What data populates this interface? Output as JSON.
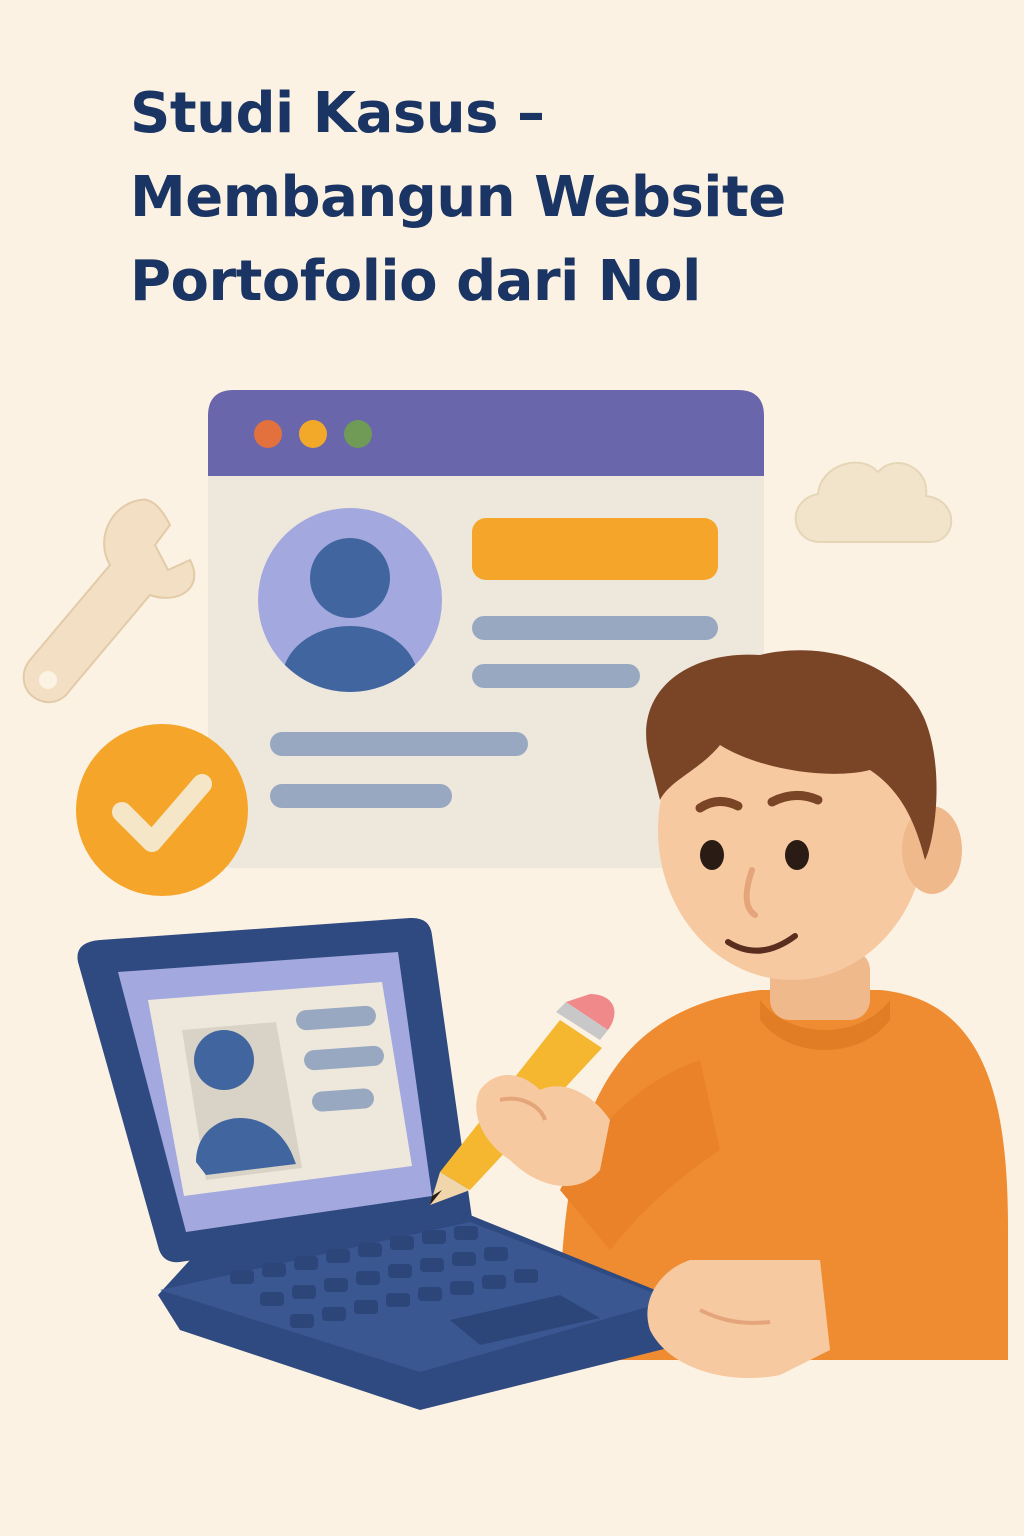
{
  "title": {
    "lines": [
      "Studi Kasus –",
      "Membangun Website",
      "Portofolio dari Nol"
    ]
  },
  "colors": {
    "background": "#fcf2e3",
    "title": "#1a3563",
    "browser_header": "#6a66ac",
    "browser_body": "#eee8dc",
    "accent_orange": "#f4a52a",
    "avatar_blue": "#40659f",
    "avatar_circle": "#a3a8de",
    "text_placeholder": "#97a8c0",
    "laptop_navy": "#2f4a80",
    "sweater_orange": "#ef8b30",
    "hair_brown": "#7a4426",
    "skin": "#f6c9a0"
  },
  "icons": {
    "wrench": "wrench-icon",
    "check": "check-badge-icon",
    "cloud": "cloud-icon",
    "pencil": "pencil-icon"
  }
}
